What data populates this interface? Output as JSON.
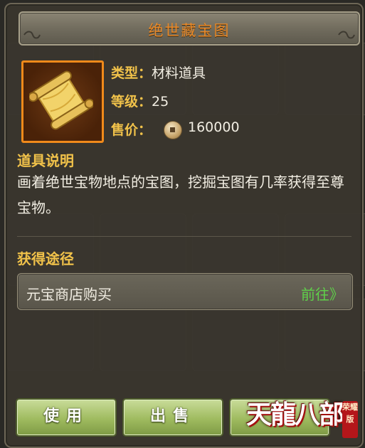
{
  "dialog": {
    "title": "绝世藏宝图"
  },
  "item": {
    "icon": "treasure-map-scroll-icon",
    "type_label": "类型：",
    "type_value": "材料道具",
    "level_label": "等级：",
    "level_value": "25",
    "price_label": "售价：",
    "price_value": "160000",
    "currency_icon": "copper-coin-icon"
  },
  "description": {
    "heading": "道具说明",
    "text": "画着绝世宝物地点的宝图，挖掘宝图有几率获得至尊宝物。"
  },
  "acquire": {
    "heading": "获得途径",
    "source": "元宝商店购买",
    "go_label": "前往》"
  },
  "buttons": {
    "use": "使用",
    "sell": "出售"
  },
  "logo": {
    "text": "天龍八部",
    "seal": "荣耀版"
  },
  "colors": {
    "title": "#e98a2a",
    "label": "#f1c24a",
    "link": "#5fd14a",
    "button": "#9fbb5f",
    "item_frame": "#f08a1a"
  }
}
